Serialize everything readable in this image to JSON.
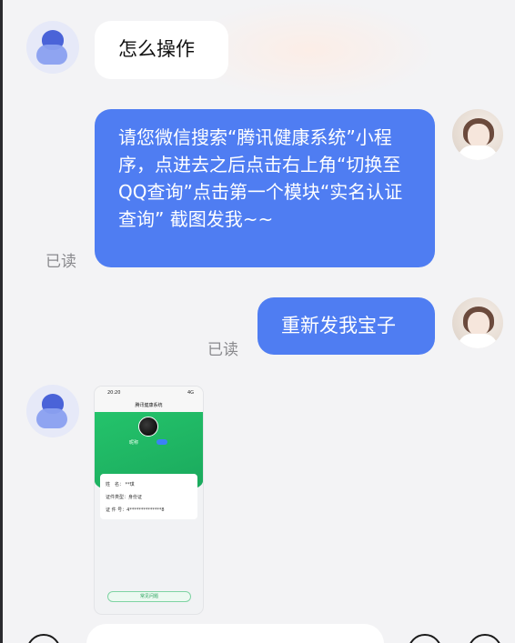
{
  "messages": [
    {
      "side": "left",
      "type": "text",
      "text": "怎么操作"
    },
    {
      "side": "right",
      "type": "text",
      "text": "请您微信搜索“腾讯健康系统”小程序，点进去之后点击右上角“切换至QQ查询”点击第一个模块“实名认证查询” 截图发我~~",
      "status": "已读"
    },
    {
      "side": "right",
      "type": "text",
      "text": "重新发我宝子",
      "status": "已读"
    },
    {
      "side": "left",
      "type": "image",
      "screenshot": {
        "time": "20:20",
        "signal": "4G",
        "app_title": "腾讯健康系统",
        "nickname": "昵称",
        "row1": "姓　名：  **琪",
        "row2": "证件类型：身份证",
        "row3": "证 件 号：4**************8",
        "button": "常见问题"
      }
    }
  ],
  "icons": {
    "bot_avatar": "bot-avatar-icon",
    "user_avatar": "user-avatar-photo",
    "bottom_left": "voice-icon",
    "bottom_right_1": "emoji-icon",
    "bottom_right_2": "plus-icon"
  },
  "colors": {
    "bubble_blue": "#4f7df2",
    "bubble_white": "#ffffff",
    "background": "#f3f3f5",
    "read_text": "#8a8a8e"
  }
}
